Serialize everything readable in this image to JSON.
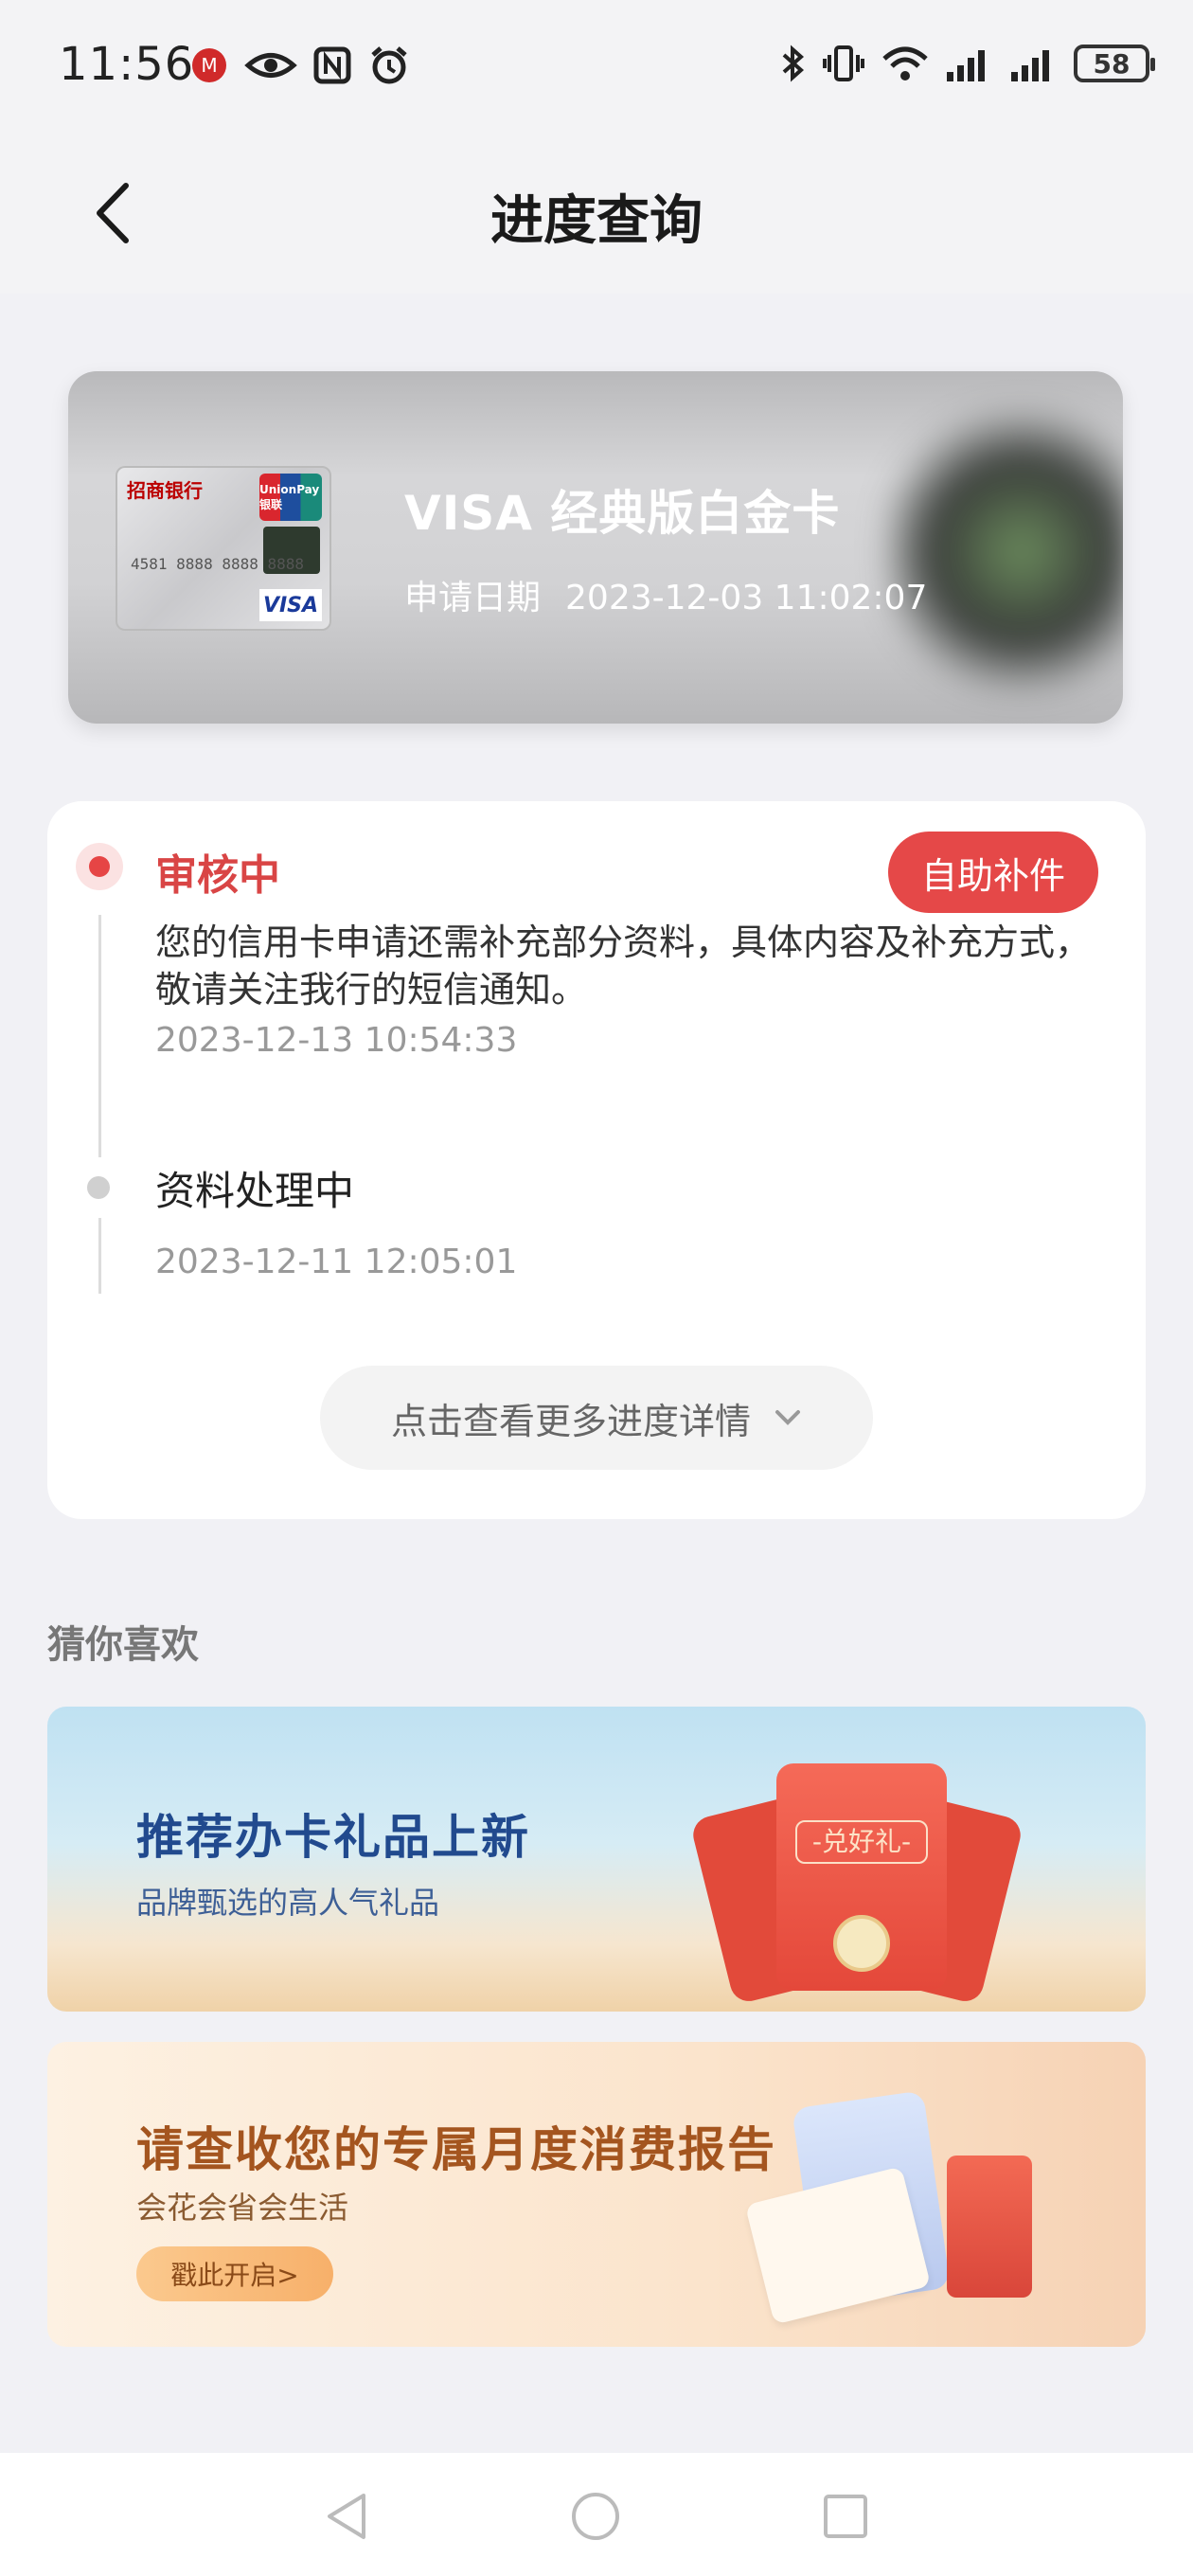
{
  "status_bar": {
    "time": "11:56",
    "battery": "58",
    "icons": [
      "cmb-app-icon",
      "eye-icon",
      "nfc-icon",
      "alarm-icon",
      "bluetooth-icon",
      "vibrate-icon",
      "wifi-icon",
      "signal-icon",
      "signal-icon"
    ]
  },
  "header": {
    "title": "进度查询"
  },
  "card": {
    "name": "VISA 经典版白金卡",
    "apply_label": "申请日期",
    "apply_date": "2023-12-03 11:02:07",
    "image": {
      "bank_name": "招商银行",
      "network_top": "UnionPay 银联",
      "number": "4581 8888 8888 8888",
      "network_bottom": "VISA"
    }
  },
  "progress": {
    "steps": [
      {
        "status": "审核中",
        "description": "您的信用卡申请还需补充部分资料，具体内容及补充方式，敬请关注我行的短信通知。",
        "time": "2023-12-13 10:54:33",
        "action": "自助补件",
        "active": true
      },
      {
        "status": "资料处理中",
        "time": "2023-12-11 12:05:01",
        "active": false
      }
    ],
    "more_label": "点击查看更多进度详情"
  },
  "recommend": {
    "section_title": "猜你喜欢",
    "banners": [
      {
        "title": "推荐办卡礼品上新",
        "subtitle": "品牌甄选的高人气礼品",
        "badge": "-兑好礼-"
      },
      {
        "title": "请查收您的专属月度消费报告",
        "subtitle": "会花会省会生活",
        "button": "戳此开启>"
      }
    ]
  },
  "colors": {
    "accent_red": "#e54848",
    "background": "#f1f1f5"
  }
}
